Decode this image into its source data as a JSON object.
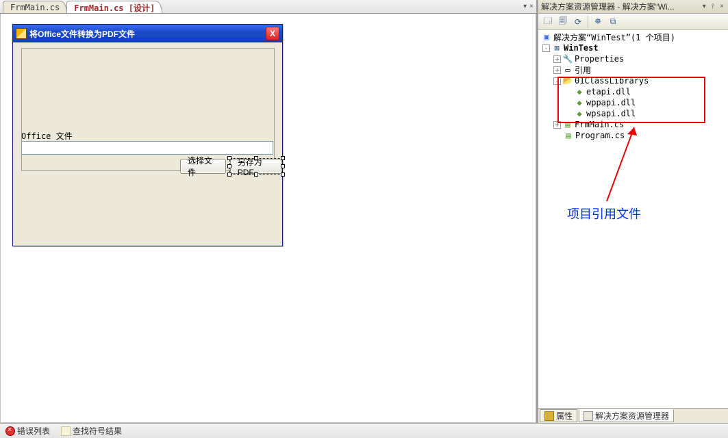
{
  "tabs": {
    "doc1": "FrmMain.cs",
    "doc2": "FrmMain.cs [设计]",
    "dropdown_glyph": "▾",
    "close_glyph": "×"
  },
  "form": {
    "title": "将Office文件转换为PDF文件",
    "label_office": "Office 文件",
    "input_value": "",
    "btn_select": "选择文件",
    "btn_save": "另存为PDF",
    "close_glyph": "X"
  },
  "side": {
    "title": "解决方案资源管理器 - 解决方案“Wi...",
    "pin_glyph": "📌",
    "close_glyph": "×",
    "dropdown_glyph": "▾"
  },
  "toolbar": {
    "b1": "🗔",
    "b2": "🗐",
    "b3": "⟳",
    "b4": "⛯",
    "b5": "⧉"
  },
  "tree": {
    "solution": "解决方案“WinTest”(1 个项目)",
    "project": "WinTest",
    "properties": "Properties",
    "references": "引用",
    "folder1": "01ClassLibrarys",
    "dll1": "etapi.dll",
    "dll2": "wppapi.dll",
    "dll3": "wpsapi.dll",
    "file1": "FrmMain.cs",
    "file2": "Program.cs"
  },
  "annotation": "项目引用文件",
  "side_tabs": {
    "tab1": "属性",
    "tab2": "解决方案资源管理器"
  },
  "bottom": {
    "item1": "错误列表",
    "item2": "查找符号结果"
  }
}
